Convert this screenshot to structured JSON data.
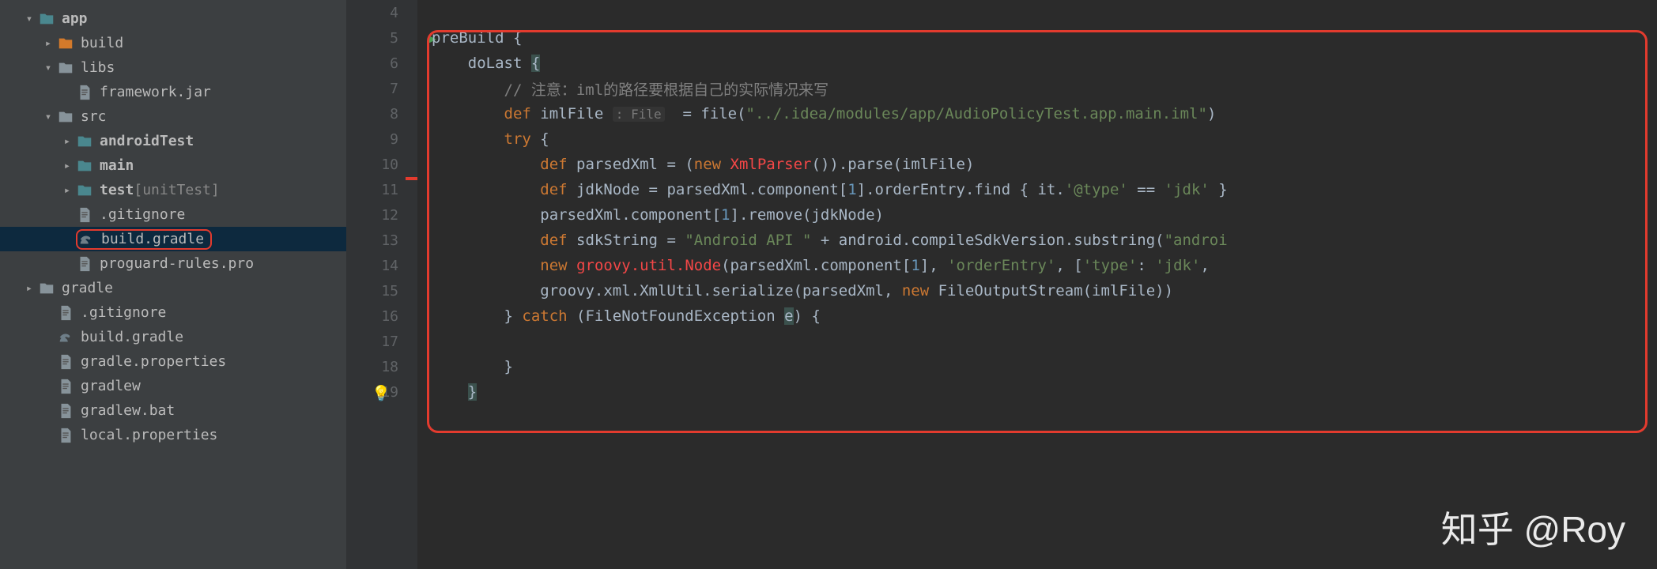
{
  "sidebar": {
    "items": [
      {
        "label": "app",
        "bold": true,
        "arrow": "down",
        "icon": "folder-teal",
        "indent": 1
      },
      {
        "label": "build",
        "arrow": "right",
        "icon": "folder-orange",
        "indent": 2
      },
      {
        "label": "libs",
        "arrow": "down",
        "icon": "folder-gray",
        "indent": 2
      },
      {
        "label": "framework.jar",
        "arrow": "",
        "icon": "file",
        "indent": 3
      },
      {
        "label": "src",
        "arrow": "down",
        "icon": "folder-gray",
        "indent": 2
      },
      {
        "label": "androidTest",
        "bold": true,
        "arrow": "right",
        "icon": "folder-teal",
        "indent": 3
      },
      {
        "label": "main",
        "bold": true,
        "arrow": "right",
        "icon": "folder-teal",
        "indent": 3
      },
      {
        "label": "test",
        "suffix": " [unitTest]",
        "bold": true,
        "arrow": "right",
        "icon": "folder-teal",
        "indent": 3
      },
      {
        "label": ".gitignore",
        "arrow": "",
        "icon": "file",
        "indent": 3
      },
      {
        "label": "build.gradle",
        "arrow": "",
        "icon": "gradle",
        "indent": 3,
        "selected": true,
        "highlighted": true
      },
      {
        "label": "proguard-rules.pro",
        "arrow": "",
        "icon": "file",
        "indent": 3
      },
      {
        "label": "gradle",
        "arrow": "right",
        "icon": "folder-gray",
        "indent": 1
      },
      {
        "label": ".gitignore",
        "arrow": "",
        "icon": "file",
        "indent": 2
      },
      {
        "label": "build.gradle",
        "arrow": "",
        "icon": "gradle",
        "indent": 2
      },
      {
        "label": "gradle.properties",
        "arrow": "",
        "icon": "file",
        "indent": 2
      },
      {
        "label": "gradlew",
        "arrow": "",
        "icon": "file",
        "indent": 2
      },
      {
        "label": "gradlew.bat",
        "arrow": "",
        "icon": "file",
        "indent": 2
      },
      {
        "label": "local.properties",
        "arrow": "",
        "icon": "file",
        "indent": 2
      }
    ]
  },
  "editor": {
    "lineNumbers": [
      "4",
      "5",
      "6",
      "7",
      "8",
      "9",
      "10",
      "11",
      "12",
      "13",
      "14",
      "15",
      "16",
      "17",
      "18",
      "19"
    ],
    "runLine": 1,
    "code": [
      [],
      [
        {
          "t": "plain",
          "v": "preBuild {"
        }
      ],
      [
        {
          "t": "plain",
          "v": "    doLast "
        },
        {
          "t": "hl",
          "v": "{"
        }
      ],
      [
        {
          "t": "plain",
          "v": "        "
        },
        {
          "t": "comment",
          "v": "// 注意：iml的路径要根据自己的实际情况来写"
        }
      ],
      [
        {
          "t": "plain",
          "v": "        "
        },
        {
          "t": "kw",
          "v": "def"
        },
        {
          "t": "plain",
          "v": " imlFile "
        },
        {
          "t": "hint",
          "v": ": File"
        },
        {
          "t": "plain",
          "v": "  = file("
        },
        {
          "t": "str",
          "v": "\"../.idea/modules/app/AudioPolicyTest.app.main.iml\""
        },
        {
          "t": "plain",
          "v": ")"
        }
      ],
      [
        {
          "t": "plain",
          "v": "        "
        },
        {
          "t": "kw",
          "v": "try"
        },
        {
          "t": "plain",
          "v": " {"
        }
      ],
      [
        {
          "t": "plain",
          "v": "            "
        },
        {
          "t": "kw",
          "v": "def"
        },
        {
          "t": "plain",
          "v": " parsedXml = ("
        },
        {
          "t": "kw",
          "v": "new"
        },
        {
          "t": "plain",
          "v": " "
        },
        {
          "t": "err",
          "v": "XmlParser"
        },
        {
          "t": "plain",
          "v": "()).parse(imlFile)"
        }
      ],
      [
        {
          "t": "plain",
          "v": "            "
        },
        {
          "t": "kw",
          "v": "def"
        },
        {
          "t": "plain",
          "v": " jdkNode = parsedXml.component["
        },
        {
          "t": "num",
          "v": "1"
        },
        {
          "t": "plain",
          "v": "].orderEntry.find { it."
        },
        {
          "t": "str",
          "v": "'@type'"
        },
        {
          "t": "plain",
          "v": " == "
        },
        {
          "t": "str",
          "v": "'jdk'"
        },
        {
          "t": "plain",
          "v": " }"
        }
      ],
      [
        {
          "t": "plain",
          "v": "            parsedXml.component["
        },
        {
          "t": "num",
          "v": "1"
        },
        {
          "t": "plain",
          "v": "].remove(jdkNode)"
        }
      ],
      [
        {
          "t": "plain",
          "v": "            "
        },
        {
          "t": "kw",
          "v": "def"
        },
        {
          "t": "plain",
          "v": " sdkString = "
        },
        {
          "t": "str",
          "v": "\"Android API \""
        },
        {
          "t": "plain",
          "v": " + android.compileSdkVersion.substring("
        },
        {
          "t": "str",
          "v": "\"androi"
        }
      ],
      [
        {
          "t": "plain",
          "v": "            "
        },
        {
          "t": "kw",
          "v": "new"
        },
        {
          "t": "plain",
          "v": " "
        },
        {
          "t": "err",
          "v": "groovy.util.Node"
        },
        {
          "t": "plain",
          "v": "(parsedXml.component["
        },
        {
          "t": "num",
          "v": "1"
        },
        {
          "t": "plain",
          "v": "], "
        },
        {
          "t": "str",
          "v": "'orderEntry'"
        },
        {
          "t": "plain",
          "v": ", ["
        },
        {
          "t": "str",
          "v": "'type'"
        },
        {
          "t": "plain",
          "v": ": "
        },
        {
          "t": "str",
          "v": "'jdk'"
        },
        {
          "t": "plain",
          "v": ", "
        }
      ],
      [
        {
          "t": "plain",
          "v": "            groovy.xml.XmlUtil.serialize(parsedXml, "
        },
        {
          "t": "kw",
          "v": "new"
        },
        {
          "t": "plain",
          "v": " FileOutputStream(imlFile))"
        }
      ],
      [
        {
          "t": "plain",
          "v": "        } "
        },
        {
          "t": "kw",
          "v": "catch"
        },
        {
          "t": "plain",
          "v": " (FileNotFoundException "
        },
        {
          "t": "hlv",
          "v": "e"
        },
        {
          "t": "plain",
          "v": ") {"
        }
      ],
      [],
      [
        {
          "t": "plain",
          "v": "        }"
        }
      ],
      [
        {
          "t": "plain",
          "v": "    "
        },
        {
          "t": "hl",
          "v": "}"
        },
        {
          "t": "bulb",
          "v": "💡"
        }
      ]
    ]
  },
  "watermark": "知乎 @Roy"
}
